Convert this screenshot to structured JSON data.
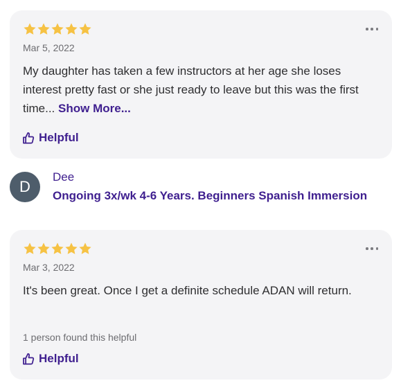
{
  "reviews": [
    {
      "rating": 5,
      "date": "Mar 5, 2022",
      "text": "My daughter has taken a few instructors at her age she loses interest pretty fast or she just ready to leave but this was the first time...",
      "show_more_label": "Show More...",
      "helpful_label": "Helpful",
      "found_helpful": ""
    },
    {
      "rating": 5,
      "date": "Mar 3, 2022",
      "text": "It's been great. Once I get a definite schedule ADAN will return.",
      "show_more_label": "",
      "helpful_label": "Helpful",
      "found_helpful": "1 person found this helpful"
    }
  ],
  "reviewer": {
    "initial": "D",
    "name": "Dee",
    "class_title": "Ongoing 3x/wk 4-6 Years. Beginners Spanish Immersion"
  },
  "colors": {
    "star": "#f6c244",
    "accent": "#3f1f8f",
    "card_bg": "#f4f4f6",
    "avatar_bg": "#4e5d6b"
  },
  "icons": {
    "more": "more-horizontal-icon",
    "helpful": "thumbs-up-icon",
    "star": "star-icon"
  }
}
